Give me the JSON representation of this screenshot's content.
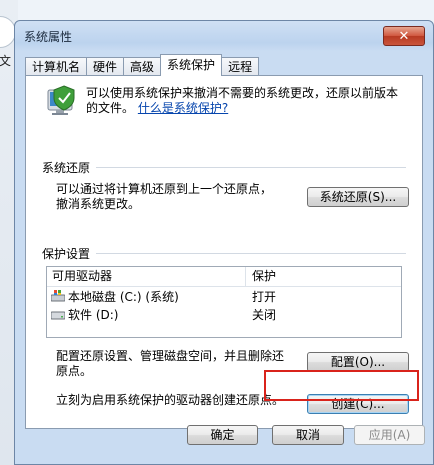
{
  "window": {
    "title": "系统属性",
    "background_text": "文"
  },
  "tabs": [
    {
      "label": "计算机名",
      "active": false
    },
    {
      "label": "硬件",
      "active": false
    },
    {
      "label": "高级",
      "active": false
    },
    {
      "label": "系统保护",
      "active": true
    },
    {
      "label": "远程",
      "active": false
    }
  ],
  "intro": {
    "text": "可以使用系统保护来撤消不需要的系统更改，还原以前版本的文件。",
    "link": "什么是系统保护?"
  },
  "restore_group": {
    "title": "系统还原",
    "description": "可以通过将计算机还原到上一个还原点，撤消系统更改。",
    "button": "系统还原(S)..."
  },
  "protection_group": {
    "title": "保护设置",
    "columns": [
      "可用驱动器",
      "保护"
    ],
    "drives": [
      {
        "name": "本地磁盘 (C:) (系统)",
        "protection": "打开",
        "icon": "system-drive-icon"
      },
      {
        "name": "软件 (D:)",
        "protection": "关闭",
        "icon": "drive-icon"
      }
    ],
    "configure_text": "配置还原设置、管理磁盘空间，并且删除还原点。",
    "configure_button": "配置(O)...",
    "create_text": "立刻为启用系统保护的驱动器创建还原点。",
    "create_button": "创建(C)..."
  },
  "footer": {
    "ok": "确定",
    "cancel": "取消",
    "apply": "应用(A)"
  },
  "colors": {
    "highlight": "#d9231b",
    "link": "#0645ad"
  }
}
